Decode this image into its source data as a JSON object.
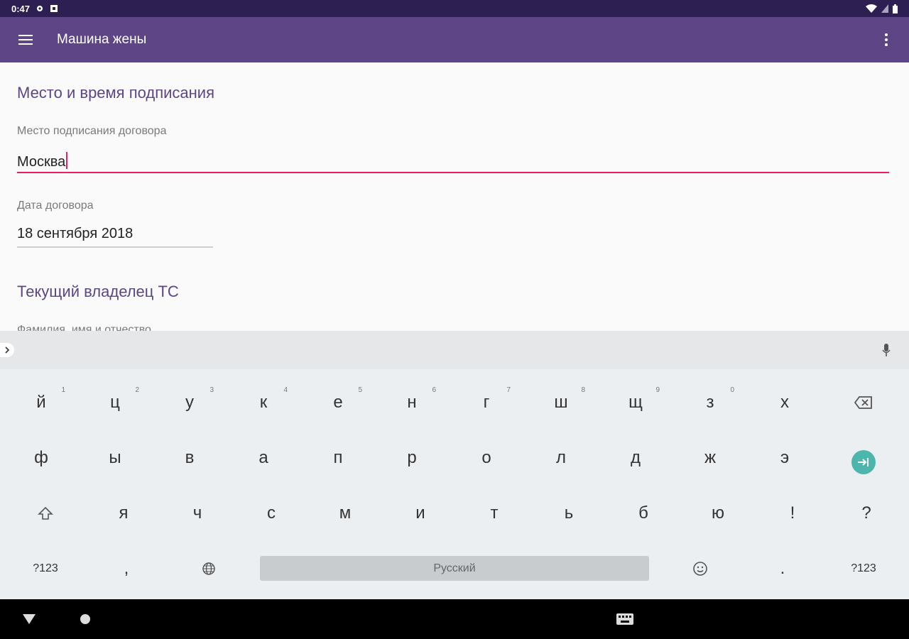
{
  "status_bar": {
    "time": "0:47"
  },
  "app_bar": {
    "title": "Машина жены"
  },
  "form": {
    "section1_title": "Место и время подписания",
    "place_label": "Место подписания договора",
    "place_value": "Москва",
    "date_label": "Дата договора",
    "date_value": "18 сентября 2018",
    "section2_title": "Текущий владелец ТС",
    "name_label_partial": "Фамилия, имя и отчество"
  },
  "keyboard": {
    "row1": [
      {
        "label": "й",
        "hint": "1"
      },
      {
        "label": "ц",
        "hint": "2"
      },
      {
        "label": "у",
        "hint": "3"
      },
      {
        "label": "к",
        "hint": "4"
      },
      {
        "label": "е",
        "hint": "5"
      },
      {
        "label": "н",
        "hint": "6"
      },
      {
        "label": "г",
        "hint": "7"
      },
      {
        "label": "ш",
        "hint": "8"
      },
      {
        "label": "щ",
        "hint": "9"
      },
      {
        "label": "з",
        "hint": "0"
      },
      {
        "label": "х",
        "hint": ""
      }
    ],
    "row2": [
      "ф",
      "ы",
      "в",
      "а",
      "п",
      "р",
      "о",
      "л",
      "д",
      "ж",
      "э"
    ],
    "row3": [
      "я",
      "ч",
      "с",
      "м",
      "и",
      "т",
      "ь",
      "б",
      "ю",
      "!",
      "?"
    ],
    "symbols_label": "?123",
    "comma_label": ",",
    "space_label": "Русский",
    "period_label": "."
  },
  "colors": {
    "status_bar": "#2d1f52",
    "app_bar": "#5d4586",
    "accent": "#e91e63",
    "section_title": "#5d4586",
    "enter_key": "#4db6ac"
  },
  "icons": {
    "menu": "hamburger-menu-icon",
    "overflow": "more-vert-icon",
    "mic": "mic-icon",
    "backspace": "backspace-icon",
    "enter": "next-tab-icon",
    "shift": "shift-icon",
    "globe": "globe-icon",
    "emoji": "emoji-icon"
  }
}
